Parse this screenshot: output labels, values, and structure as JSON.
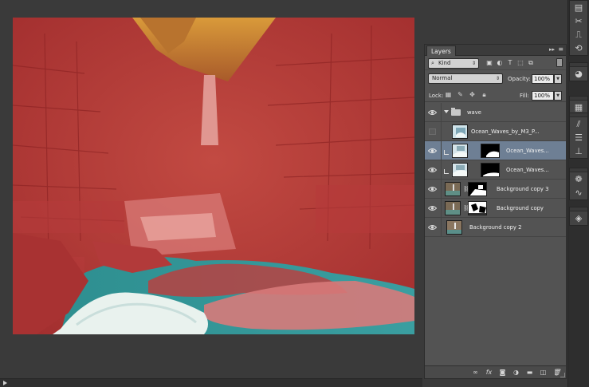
{
  "layers_panel": {
    "tab_label": "Layers",
    "collapse_glyph": "▸▸",
    "menu_glyph": "≡",
    "filter_kind": "Kind",
    "blend_mode": "Normal",
    "opacity_label": "Opacity:",
    "opacity_value": "100%",
    "lock_label": "Lock:",
    "fill_label": "Fill:",
    "fill_value": "100%",
    "layers": [
      {
        "name": "wave",
        "type": "group",
        "visible": true,
        "selected": false
      },
      {
        "name": "Ocean_Waves_by_M3_P...",
        "type": "layer",
        "visible": false,
        "selected": false
      },
      {
        "name": "Ocean_Waves...",
        "type": "masked",
        "visible": true,
        "selected": true
      },
      {
        "name": "Ocean_Waves...",
        "type": "masked",
        "visible": true,
        "selected": false
      },
      {
        "name": "Background copy 3",
        "type": "masked-linked",
        "visible": true,
        "selected": false
      },
      {
        "name": "Background copy",
        "type": "masked-linked",
        "visible": true,
        "selected": false
      },
      {
        "name": "Background copy 2",
        "type": "layer",
        "visible": true,
        "selected": false
      }
    ]
  },
  "footer_icons": [
    "link-icon",
    "fx-icon",
    "add-mask-icon",
    "adjustment-icon",
    "new-group-icon",
    "new-layer-icon",
    "trash-icon"
  ],
  "right_toolbar_icons": [
    "history-icon",
    "scissors-icon",
    "timeline-icon",
    "swatches-icon",
    "color-wheel-icon",
    "paths-icon",
    "brush-icon",
    "sliders-icon",
    "stamp-icon",
    "spectrum-icon",
    "curves-icon",
    "layers-icon"
  ],
  "colors": {
    "quick_mask_overlay": "#c43434",
    "selected_layer": "#6e7f94",
    "panel_bg": "#535353",
    "workspace_bg": "#3a3a3a"
  }
}
